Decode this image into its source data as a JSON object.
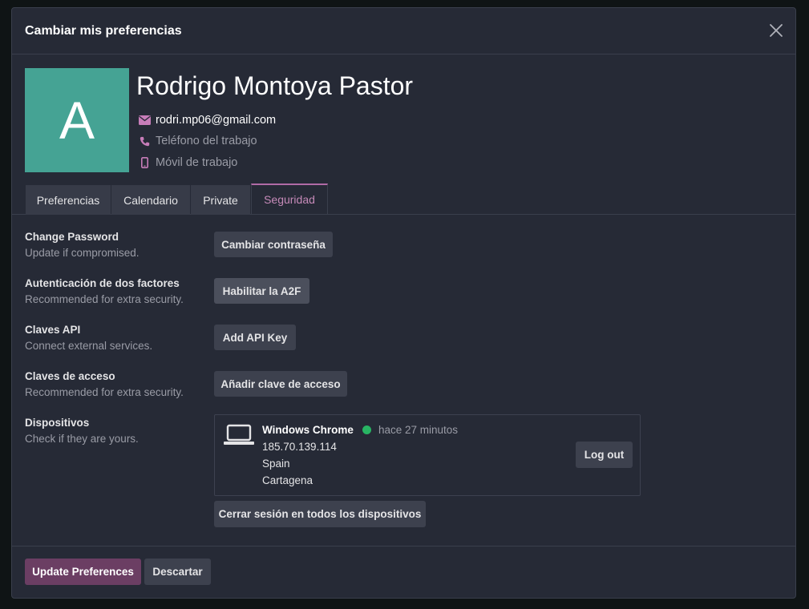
{
  "dialog": {
    "title": "Cambiar mis preferencias"
  },
  "profile": {
    "avatar_letter": "A",
    "avatar_color": "#45a394",
    "name": "Rodrigo Montoya Pastor",
    "email": "rodri.mp06@gmail.com",
    "work_phone_placeholder": "Teléfono del trabajo",
    "work_mobile_placeholder": "Móvil de trabajo"
  },
  "tabs": [
    {
      "label": "Preferencias",
      "active": false
    },
    {
      "label": "Calendario",
      "active": false
    },
    {
      "label": "Private",
      "active": false
    },
    {
      "label": "Seguridad",
      "active": true
    }
  ],
  "security": {
    "change_password": {
      "label": "Change Password",
      "description": "Update if compromised.",
      "button": "Cambiar contraseña"
    },
    "two_factor": {
      "label": "Autenticación de dos factores",
      "description": "Recommended for extra security.",
      "button": "Habilitar la A2F"
    },
    "api_keys": {
      "label": "Claves API",
      "description": "Connect external services.",
      "button": "Add API Key"
    },
    "passkeys": {
      "label": "Claves de acceso",
      "description": "Recommended for extra security.",
      "button": "Añadir clave de acceso"
    },
    "devices": {
      "label": "Dispositivos",
      "description": "Check if they are yours.",
      "list": [
        {
          "name": "Windows Chrome",
          "status_color": "#28b463",
          "last_active": "hace 27 minutos",
          "ip": "185.70.139.114",
          "country": "Spain",
          "city": "Cartagena",
          "logout_button": "Log out"
        }
      ],
      "logout_all_button": "Cerrar sesión en todos los dispositivos"
    }
  },
  "footer": {
    "update_button": "Update Preferences",
    "discard_button": "Descartar"
  },
  "colors": {
    "accent": "#b06aa6",
    "primary_button": "#6b3e63"
  }
}
